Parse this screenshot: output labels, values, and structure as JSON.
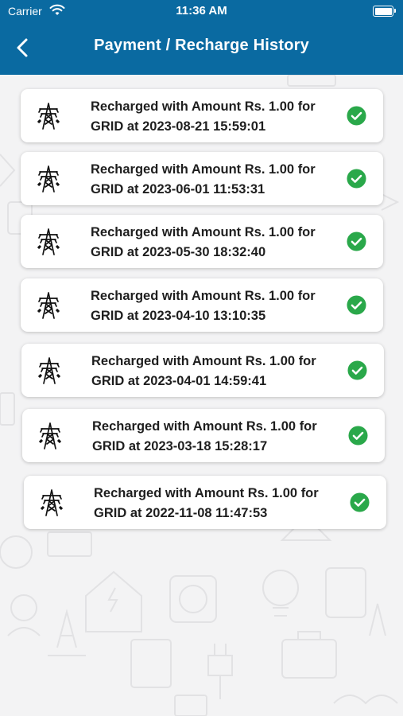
{
  "status_bar": {
    "carrier": "Carrier",
    "time": "11:36 AM"
  },
  "header": {
    "title": "Payment / Recharge History"
  },
  "history": [
    {
      "line1": "Recharged with Amount Rs. 1.00 for",
      "line2": "GRID at 2023-08-21 15:59:01"
    },
    {
      "line1": "Recharged with Amount Rs. 1.00 for",
      "line2": "GRID at 2023-06-01 11:53:31"
    },
    {
      "line1": "Recharged with Amount Rs. 1.00 for",
      "line2": "GRID at 2023-05-30 18:32:40"
    },
    {
      "line1": "Recharged with Amount Rs. 1.00 for",
      "line2": "GRID at 2023-04-10 13:10:35"
    },
    {
      "line1": "Recharged with Amount Rs. 1.00 for",
      "line2": "GRID at 2023-04-01 14:59:41"
    },
    {
      "line1": "Recharged with Amount Rs. 1.00 for",
      "line2": "GRID at 2023-03-18 15:28:17"
    },
    {
      "line1": "Recharged with Amount Rs. 1.00 for",
      "line2": "GRID at 2022-11-08 11:47:53"
    }
  ],
  "colors": {
    "header": "#0a6aa1",
    "success": "#2aa84a"
  },
  "icons": {
    "row": "transmission-tower-icon",
    "status": "check-circle-icon",
    "back": "chevron-left-icon"
  }
}
